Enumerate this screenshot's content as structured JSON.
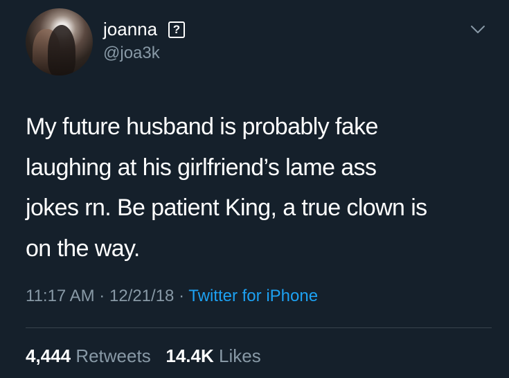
{
  "author": {
    "display_name": "joanna",
    "badge": "?",
    "handle": "@joa3k"
  },
  "tweet": {
    "lines": [
      "My future husband is probably fake",
      "laughing at his girlfriend’s lame ass",
      "jokes rn. Be patient King, a true clown is",
      "on the way."
    ],
    "time": "11:17 AM",
    "date": "12/21/18",
    "source": "Twitter for iPhone",
    "separator": "·"
  },
  "stats": {
    "retweets_count": "4,444",
    "retweets_label": "Retweets",
    "likes_count": "14.4K",
    "likes_label": "Likes"
  },
  "icons": {
    "menu": "chevron-down-icon",
    "badge": "question-box-icon"
  },
  "colors": {
    "background": "#15202b",
    "text": "#ffffff",
    "secondary": "#8899a6",
    "link": "#1da1f2",
    "divider": "#38444d"
  }
}
